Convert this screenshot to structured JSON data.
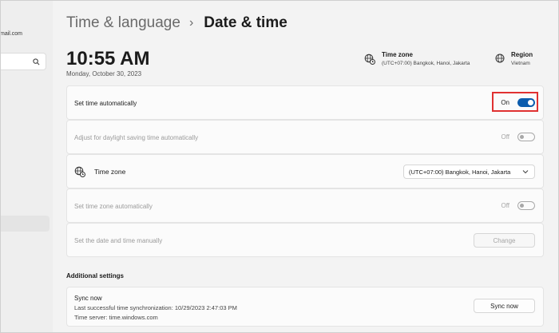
{
  "sidebar": {
    "email_fragment": "mail.com"
  },
  "breadcrumb": {
    "parent": "Time & language",
    "separator": "›",
    "current": "Date & time"
  },
  "clock": {
    "time": "10:55 AM",
    "date": "Monday, October 30, 2023"
  },
  "header_info": {
    "timezone_title": "Time zone",
    "timezone_value": "(UTC+07:00) Bangkok, Hanoi, Jakarta",
    "region_title": "Region",
    "region_value": "Vietnam"
  },
  "settings": {
    "set_time_auto": {
      "label": "Set time automatically",
      "state": "On"
    },
    "daylight": {
      "label": "Adjust for daylight saving time automatically",
      "state": "Off"
    },
    "time_zone": {
      "label": "Time zone",
      "value": "(UTC+07:00) Bangkok, Hanoi, Jakarta"
    },
    "set_tz_auto": {
      "label": "Set time zone automatically",
      "state": "Off"
    },
    "manual": {
      "label": "Set the date and time manually",
      "button": "Change"
    }
  },
  "additional": {
    "title": "Additional settings",
    "sync_title": "Sync now",
    "last_sync": "Last successful time synchronization: 10/29/2023 2:47:03 PM",
    "server": "Time server: time.windows.com",
    "sync_button": "Sync now"
  },
  "colors": {
    "accent": "#0b5cad",
    "highlight": "#e03131",
    "background": "#f3f3f3"
  }
}
